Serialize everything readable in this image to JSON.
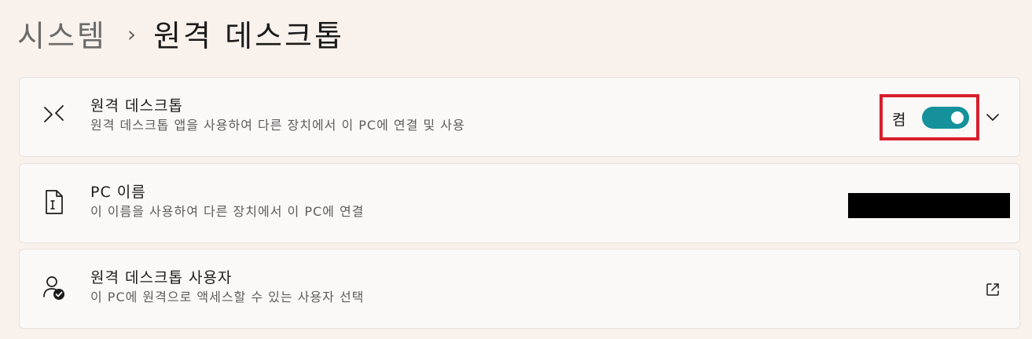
{
  "breadcrumb": {
    "parent": "시스템",
    "separator": "›",
    "current": "원격 데스크톱"
  },
  "cards": {
    "remote_desktop": {
      "icon": "remote-desktop-icon",
      "title": "원격 데스크톱",
      "description": "원격 데스크톱 앱을 사용하여 다른 장치에서 이 PC에 연결 및 사용",
      "toggle_label": "켬",
      "toggle_on": true
    },
    "pc_name": {
      "icon": "document-icon",
      "title": "PC 이름",
      "description": "이 이름을 사용하여 다른 장치에서 이 PC에 연결",
      "value_redacted": true
    },
    "remote_users": {
      "icon": "user-check-icon",
      "title": "원격 데스크톱 사용자",
      "description": "이 PC에 원격으로 액세스할 수 있는 사용자 선택"
    }
  },
  "colors": {
    "background": "#f8f1ec",
    "card": "#fbf9f8",
    "accent": "#14919b",
    "highlight_border": "#d61f2c"
  }
}
